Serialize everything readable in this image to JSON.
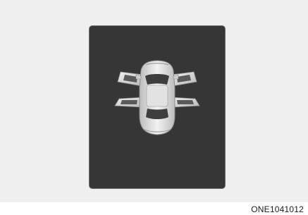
{
  "display": {
    "indicator": "door-open-car-icon",
    "colors": {
      "screen": "#363636",
      "car_body": "#e6e6e6",
      "background": "#efefef"
    }
  },
  "figure": {
    "code": "ONE1041012"
  }
}
